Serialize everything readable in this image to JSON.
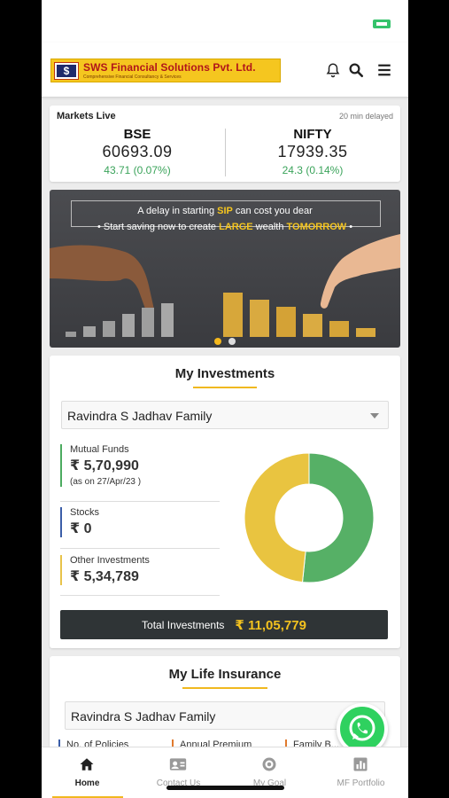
{
  "header": {
    "logo_name": "SWS Financial Solutions Pvt. Ltd.",
    "logo_tagline": "Comprehensive Financial Consultancy & Services",
    "icons": [
      "bell-icon",
      "search-icon",
      "menu-icon"
    ]
  },
  "markets": {
    "title": "Markets Live",
    "delay_note": "20 min delayed",
    "indices": [
      {
        "name": "BSE",
        "value": "60693.09",
        "change": "43.71",
        "change_pct": "(0.07%)"
      },
      {
        "name": "NIFTY",
        "value": "17939.35",
        "change": "24.3",
        "change_pct": "(0.14%)"
      }
    ]
  },
  "banner": {
    "line1_pre": "A delay in starting ",
    "line1_hl": "SIP",
    "line1_post": " can cost you dear",
    "line2_pre": "Start saving now to create ",
    "line2_hl1": "LARGE",
    "line2_mid": " wealth ",
    "line2_hl2": "TOMORROW",
    "active_slide": 1,
    "slide_count": 2
  },
  "investments": {
    "title": "My Investments",
    "family_select": "Ravindra S Jadhav Family",
    "items": [
      {
        "label": "Mutual Funds",
        "value": "₹ 5,70,990",
        "sub": "(as on 27/Apr/23 )",
        "color": "#4cab60"
      },
      {
        "label": "Stocks",
        "value": "₹ 0",
        "sub": "",
        "color": "#3b5ea8"
      },
      {
        "label": "Other Investments",
        "value": "₹ 5,34,789",
        "sub": "",
        "color": "#e8c34a"
      }
    ],
    "total_label": "Total Investments",
    "total_value": "₹ 11,05,779"
  },
  "chart_data": {
    "type": "pie",
    "donut": true,
    "categories": [
      "Mutual Funds",
      "Stocks",
      "Other Investments"
    ],
    "values": [
      570990,
      0,
      534789
    ],
    "colors": [
      "#56b066",
      "#3b5ea8",
      "#e9c440"
    ]
  },
  "insurance": {
    "title": "My Life Insurance",
    "family_select": "Ravindra S Jadhav Family",
    "columns": [
      "No. of Policies",
      "Annual Premium",
      "Family B..."
    ]
  },
  "bottom_nav": [
    {
      "label": "Home",
      "icon": "home-icon",
      "active": true
    },
    {
      "label": "Contact Us",
      "icon": "contact-card-icon",
      "active": false
    },
    {
      "label": "My Goal",
      "icon": "target-icon",
      "active": false
    },
    {
      "label": "MF Portfolio",
      "icon": "bar-chart-icon",
      "active": false
    }
  ],
  "colors": {
    "accent": "#f0b81f",
    "positive": "#3aa35a",
    "dark": "#2f3436",
    "whatsapp": "#2fd15f"
  }
}
